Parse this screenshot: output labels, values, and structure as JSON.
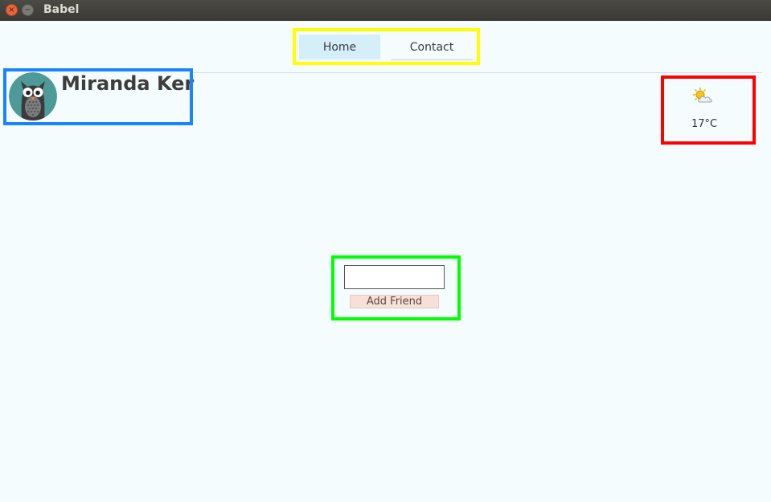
{
  "window": {
    "title": "Babel",
    "close_glyph": "×",
    "minimize_glyph": "−"
  },
  "nav": {
    "tabs": [
      {
        "label": "Home",
        "active": true
      },
      {
        "label": "Contact",
        "active": false
      }
    ]
  },
  "profile": {
    "name": "Miranda Ker",
    "avatar_icon": "owl-avatar-icon"
  },
  "weather": {
    "temperature": "17°C",
    "icon": "partly-sunny-icon"
  },
  "friend": {
    "input_value": "",
    "button_label": "Add Friend"
  },
  "colors": {
    "background": "#f5fcfd",
    "nav_active": "#d4eefa",
    "button_bg": "#f7e0d7",
    "highlight_yellow": "#ffff00",
    "highlight_blue": "#1a84ff",
    "highlight_red": "#ff0000",
    "highlight_green": "#00ff00"
  }
}
